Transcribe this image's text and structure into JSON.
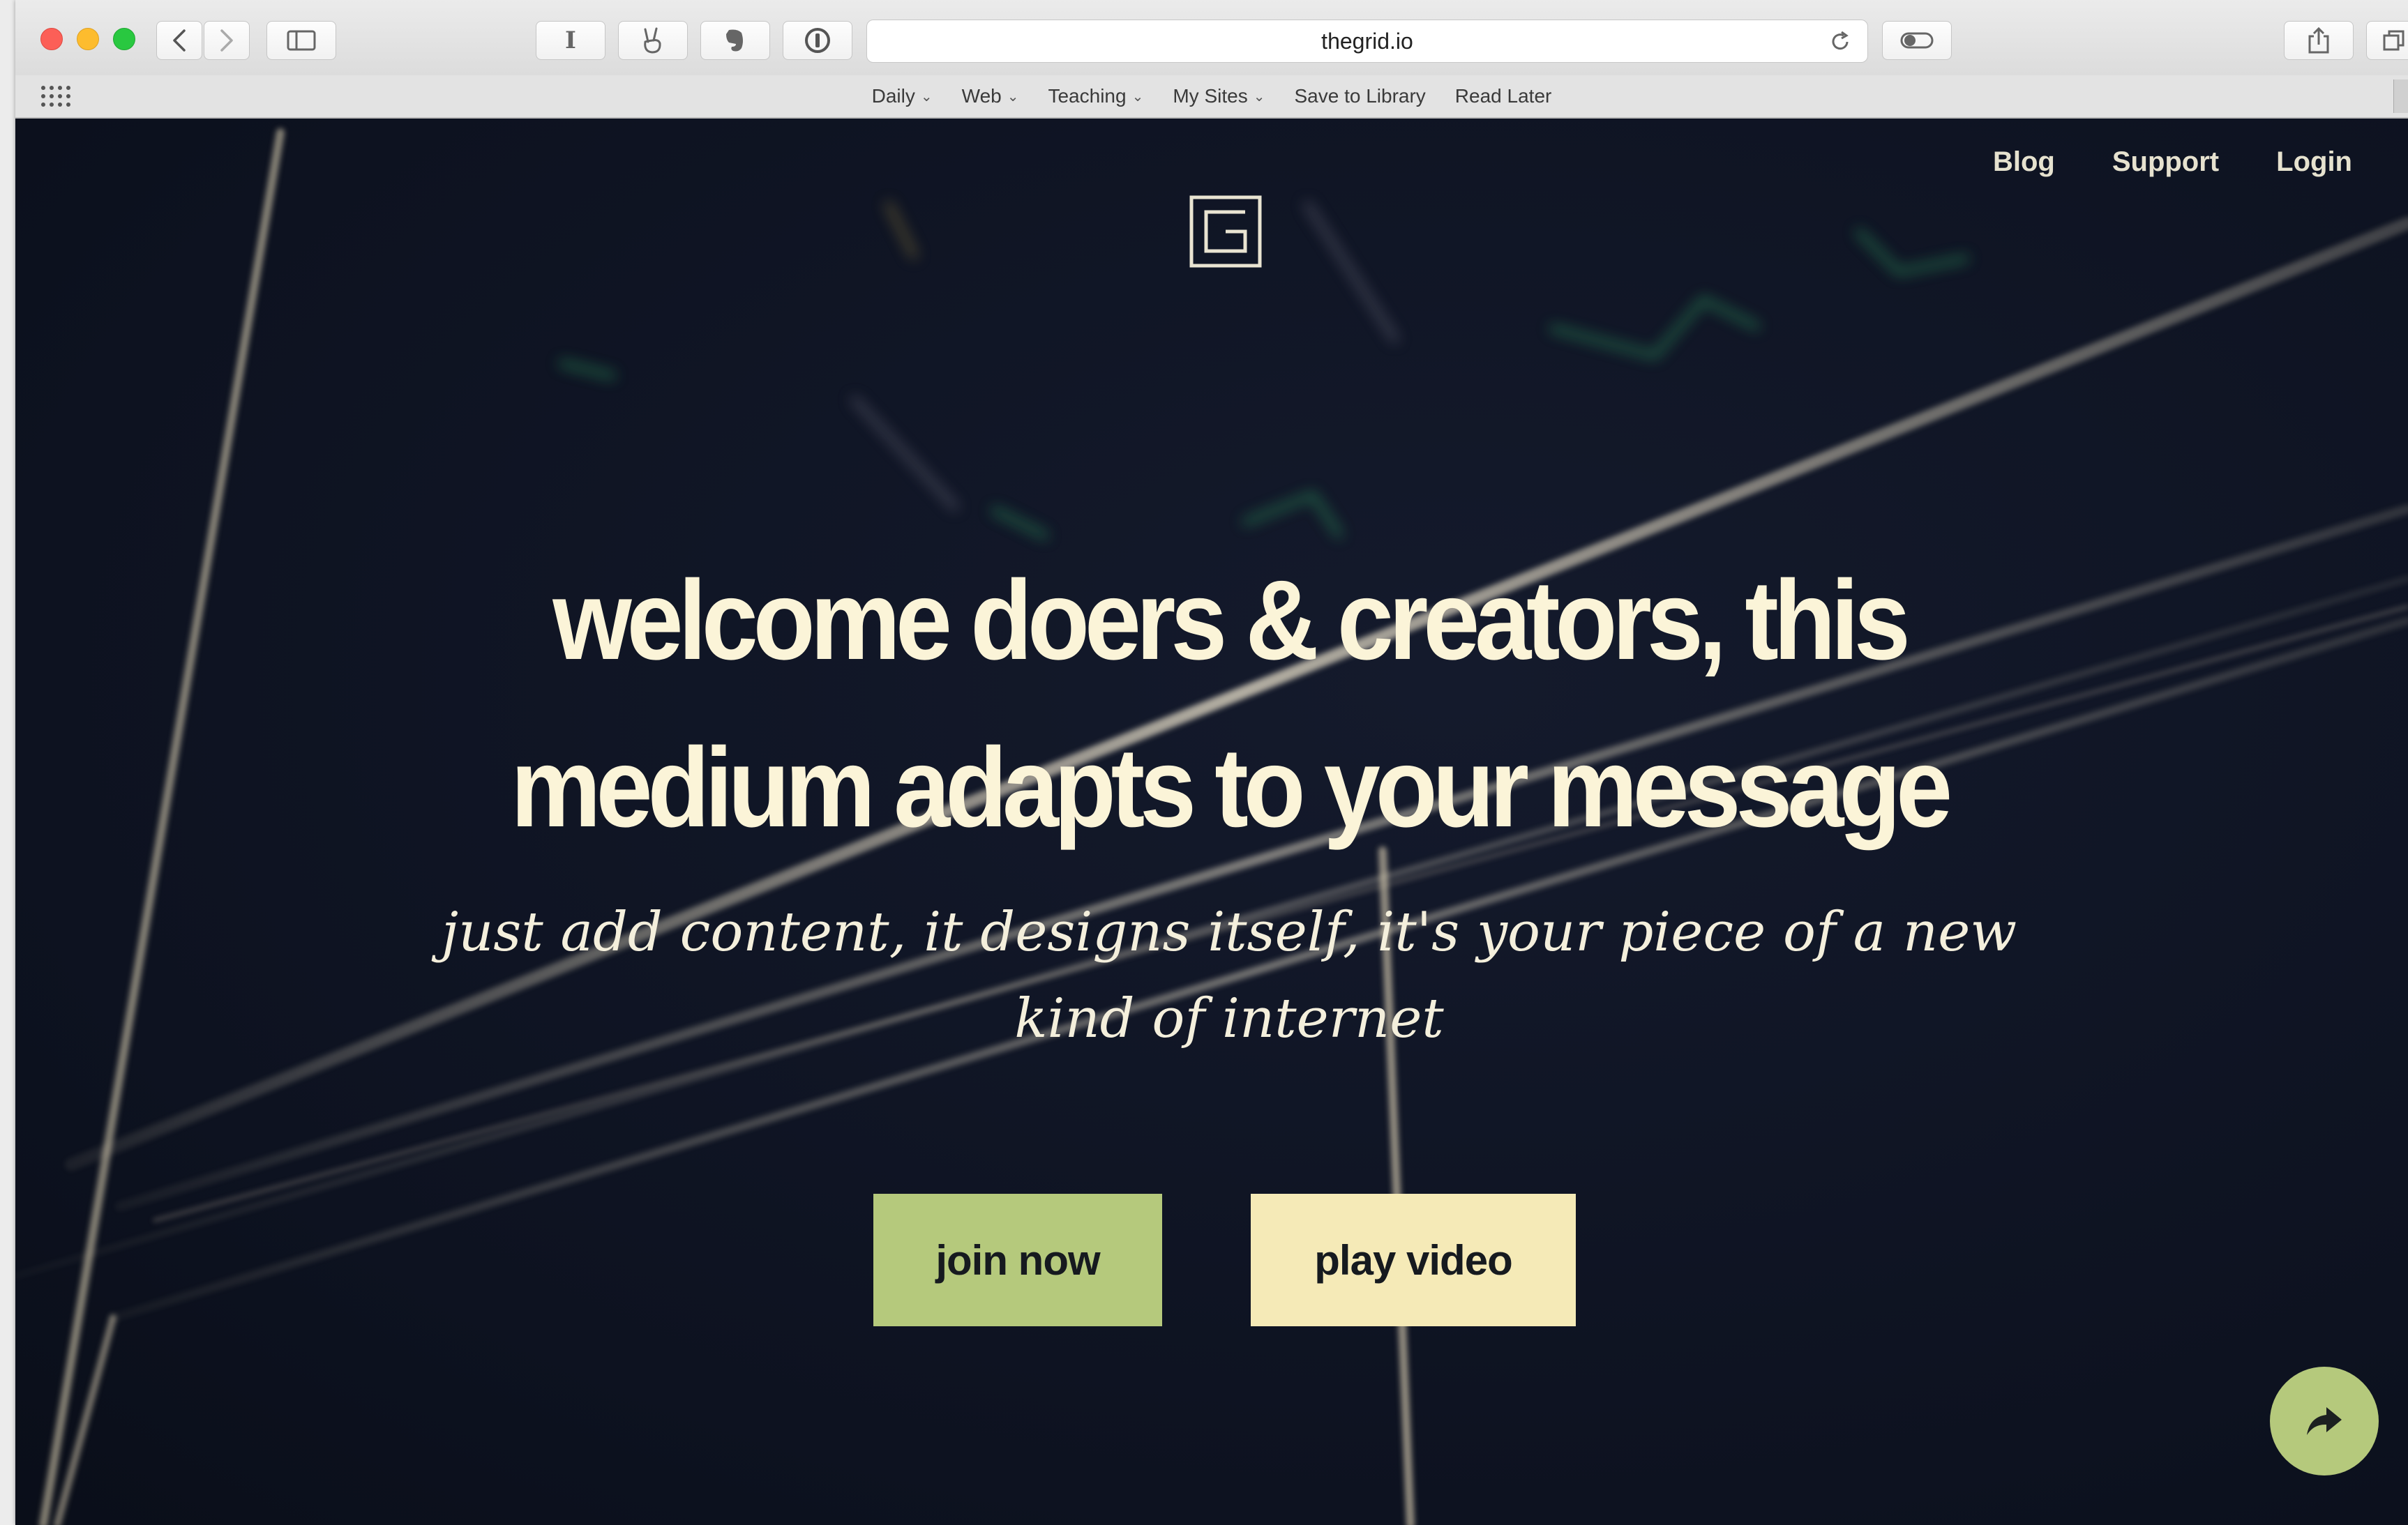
{
  "browser": {
    "url": "thegrid.io",
    "bookmarks": [
      {
        "label": "Daily",
        "dropdown": true
      },
      {
        "label": "Web",
        "dropdown": true
      },
      {
        "label": "Teaching",
        "dropdown": true
      },
      {
        "label": "My Sites",
        "dropdown": true
      },
      {
        "label": "Save to Library",
        "dropdown": false
      },
      {
        "label": "Read Later",
        "dropdown": false
      }
    ],
    "reader_button": "I",
    "icons": [
      "back-icon",
      "forward-icon",
      "sidebar-icon",
      "reader-icon",
      "peace-hand-icon",
      "evernote-icon",
      "1password-icon",
      "reload-icon",
      "toggle-icon",
      "share-icon",
      "tabs-icon",
      "apps-grid-icon"
    ]
  },
  "site": {
    "nav": {
      "blog": "Blog",
      "support": "Support",
      "login": "Login"
    },
    "headline_line1": "welcome doers & creators, this",
    "headline_line2": "medium adapts to your message",
    "tagline_line1": "just add content, it designs itself, it's your piece of a new",
    "tagline_line2": "kind of internet",
    "join_label": "join now",
    "play_label": "play video"
  },
  "colors": {
    "background": "#0f1422",
    "headline": "#fbf4d8",
    "join_button": "#b5c97c",
    "play_button": "#f5eab7",
    "share_fab": "#b5c97c"
  }
}
